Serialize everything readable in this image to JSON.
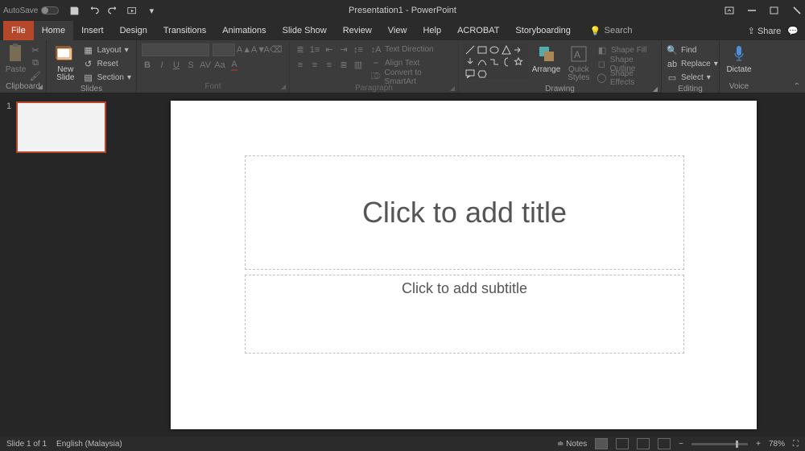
{
  "titlebar": {
    "autosave_label": "AutoSave",
    "title": "Presentation1 - PowerPoint"
  },
  "tabs": {
    "file": "File",
    "home": "Home",
    "insert": "Insert",
    "design": "Design",
    "transitions": "Transitions",
    "animations": "Animations",
    "slideshow": "Slide Show",
    "review": "Review",
    "view": "View",
    "help": "Help",
    "acrobat": "ACROBAT",
    "storyboarding": "Storyboarding",
    "search": "Search",
    "share": "Share"
  },
  "ribbon": {
    "clipboard": {
      "label": "Clipboard",
      "paste": "Paste"
    },
    "slides": {
      "label": "Slides",
      "new_slide": "New\nSlide",
      "layout": "Layout",
      "reset": "Reset",
      "section": "Section"
    },
    "font": {
      "label": "Font"
    },
    "paragraph": {
      "label": "Paragraph",
      "text_direction": "Text Direction",
      "align_text": "Align Text",
      "convert_smartart": "Convert to SmartArt"
    },
    "drawing": {
      "label": "Drawing",
      "arrange": "Arrange",
      "quick_styles": "Quick\nStyles",
      "shape_fill": "Shape Fill",
      "shape_outline": "Shape Outline",
      "shape_effects": "Shape Effects"
    },
    "editing": {
      "label": "Editing",
      "find": "Find",
      "replace": "Replace",
      "select": "Select"
    },
    "voice": {
      "label": "Voice",
      "dictate": "Dictate"
    }
  },
  "thumbnails": {
    "num1": "1"
  },
  "slide": {
    "title_placeholder": "Click to add title",
    "subtitle_placeholder": "Click to add subtitle"
  },
  "status": {
    "slide_info": "Slide 1 of 1",
    "language": "English (Malaysia)",
    "notes": "Notes",
    "zoom": "78%"
  }
}
